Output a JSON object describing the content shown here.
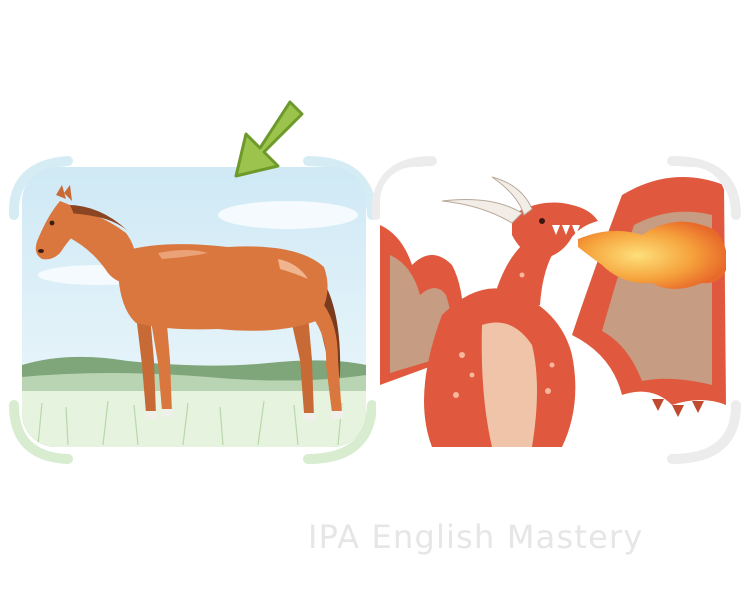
{
  "illustrations": [
    {
      "subject": "horse",
      "pointed_at": true
    },
    {
      "subject": "dragon",
      "pointed_at": false
    }
  ],
  "pointer": {
    "icon": "arrow-icon",
    "color": "#9cc44c"
  },
  "watermark": {
    "text": "IPA English Mastery"
  },
  "colors": {
    "frame_blue": "#d6ecf4",
    "frame_green": "#d8ecd0",
    "frame_grey": "#ececec",
    "horse_coat": "#d9773f",
    "dragon_red": "#e0593e",
    "fire_orange": "#f6a23c"
  }
}
